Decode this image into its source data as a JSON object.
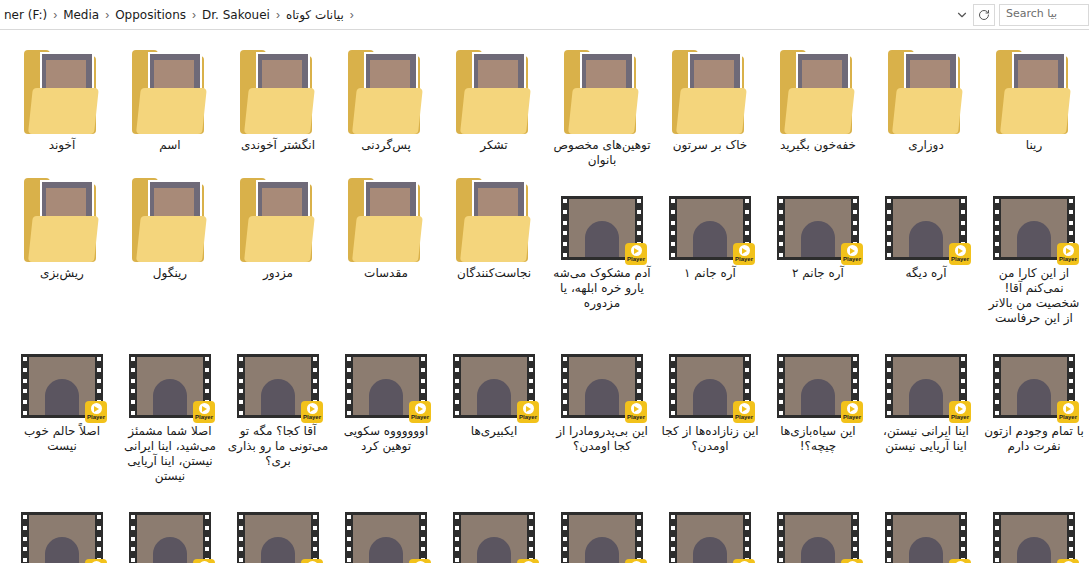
{
  "address_bar": {
    "path": [
      "ner (F:)",
      "Media",
      "Oppositions",
      "Dr. Sakouei",
      "بیانات کوتاه"
    ],
    "separator": "›"
  },
  "search": {
    "placeholder": "Search بیا"
  },
  "player_badge": "Player",
  "items": [
    {
      "name": "آخوند",
      "kind": "folder"
    },
    {
      "name": "اسم",
      "kind": "folder"
    },
    {
      "name": "انگشتر آخوندی",
      "kind": "folder"
    },
    {
      "name": "پس‌گردنی",
      "kind": "folder"
    },
    {
      "name": "تشکر",
      "kind": "folder"
    },
    {
      "name": "توهین‌های مخصوص بانوان",
      "kind": "folder"
    },
    {
      "name": "خاک بر سرتون",
      "kind": "folder"
    },
    {
      "name": "خفه‌خون بگیرید",
      "kind": "folder"
    },
    {
      "name": "دوزاری",
      "kind": "folder"
    },
    {
      "name": "رینا",
      "kind": "folder"
    },
    {
      "name": "ریش‌بزی",
      "kind": "folder"
    },
    {
      "name": "رینگول",
      "kind": "folder"
    },
    {
      "name": "مزدور",
      "kind": "folder"
    },
    {
      "name": "مقدسات",
      "kind": "folder"
    },
    {
      "name": "نجاست‌کنندگان",
      "kind": "folder"
    },
    {
      "name": "آدم مشکوک می‌شه یارو خره ابلهه، یا مزدوره",
      "kind": "video"
    },
    {
      "name": "آره جانم ۱",
      "kind": "video"
    },
    {
      "name": "آره جانم ۲",
      "kind": "video"
    },
    {
      "name": "آره دیگه",
      "kind": "video"
    },
    {
      "name": "از این کارا من نمی‌کنم آقا! شخصیت من بالاتر از این حرفاست",
      "kind": "video"
    },
    {
      "name": "اصلاً حالم خوب نیست",
      "kind": "video"
    },
    {
      "name": "اصلا شما مشمئز می‌شید، اینا ایرانی نیستن، اینا آریایی نیستن",
      "kind": "video"
    },
    {
      "name": "آقا کجا؟ مگه تو می‌تونی ما رو بذاری بری؟",
      "kind": "video"
    },
    {
      "name": "اووووووه سکویی توهین کرد",
      "kind": "video"
    },
    {
      "name": "ایکبیری‌ها",
      "kind": "video"
    },
    {
      "name": "این بی‌پدرومادرا از کجا اومدن؟",
      "kind": "video"
    },
    {
      "name": "این زنازاده‌ها از کجا اومدن؟",
      "kind": "video"
    },
    {
      "name": "این سیاه‌بازی‌ها چیچه؟!",
      "kind": "video"
    },
    {
      "name": "اینا ایرانی نیستن، اینا آریایی نیستن",
      "kind": "video"
    },
    {
      "name": "با تمام وجودم ازتون نفرت دارم",
      "kind": "video"
    },
    {
      "name": "",
      "kind": "video"
    },
    {
      "name": "",
      "kind": "video"
    },
    {
      "name": "",
      "kind": "video"
    },
    {
      "name": "",
      "kind": "video"
    },
    {
      "name": "",
      "kind": "video"
    },
    {
      "name": "",
      "kind": "video"
    },
    {
      "name": "",
      "kind": "video"
    },
    {
      "name": "",
      "kind": "video"
    },
    {
      "name": "",
      "kind": "video"
    },
    {
      "name": "",
      "kind": "video"
    }
  ]
}
